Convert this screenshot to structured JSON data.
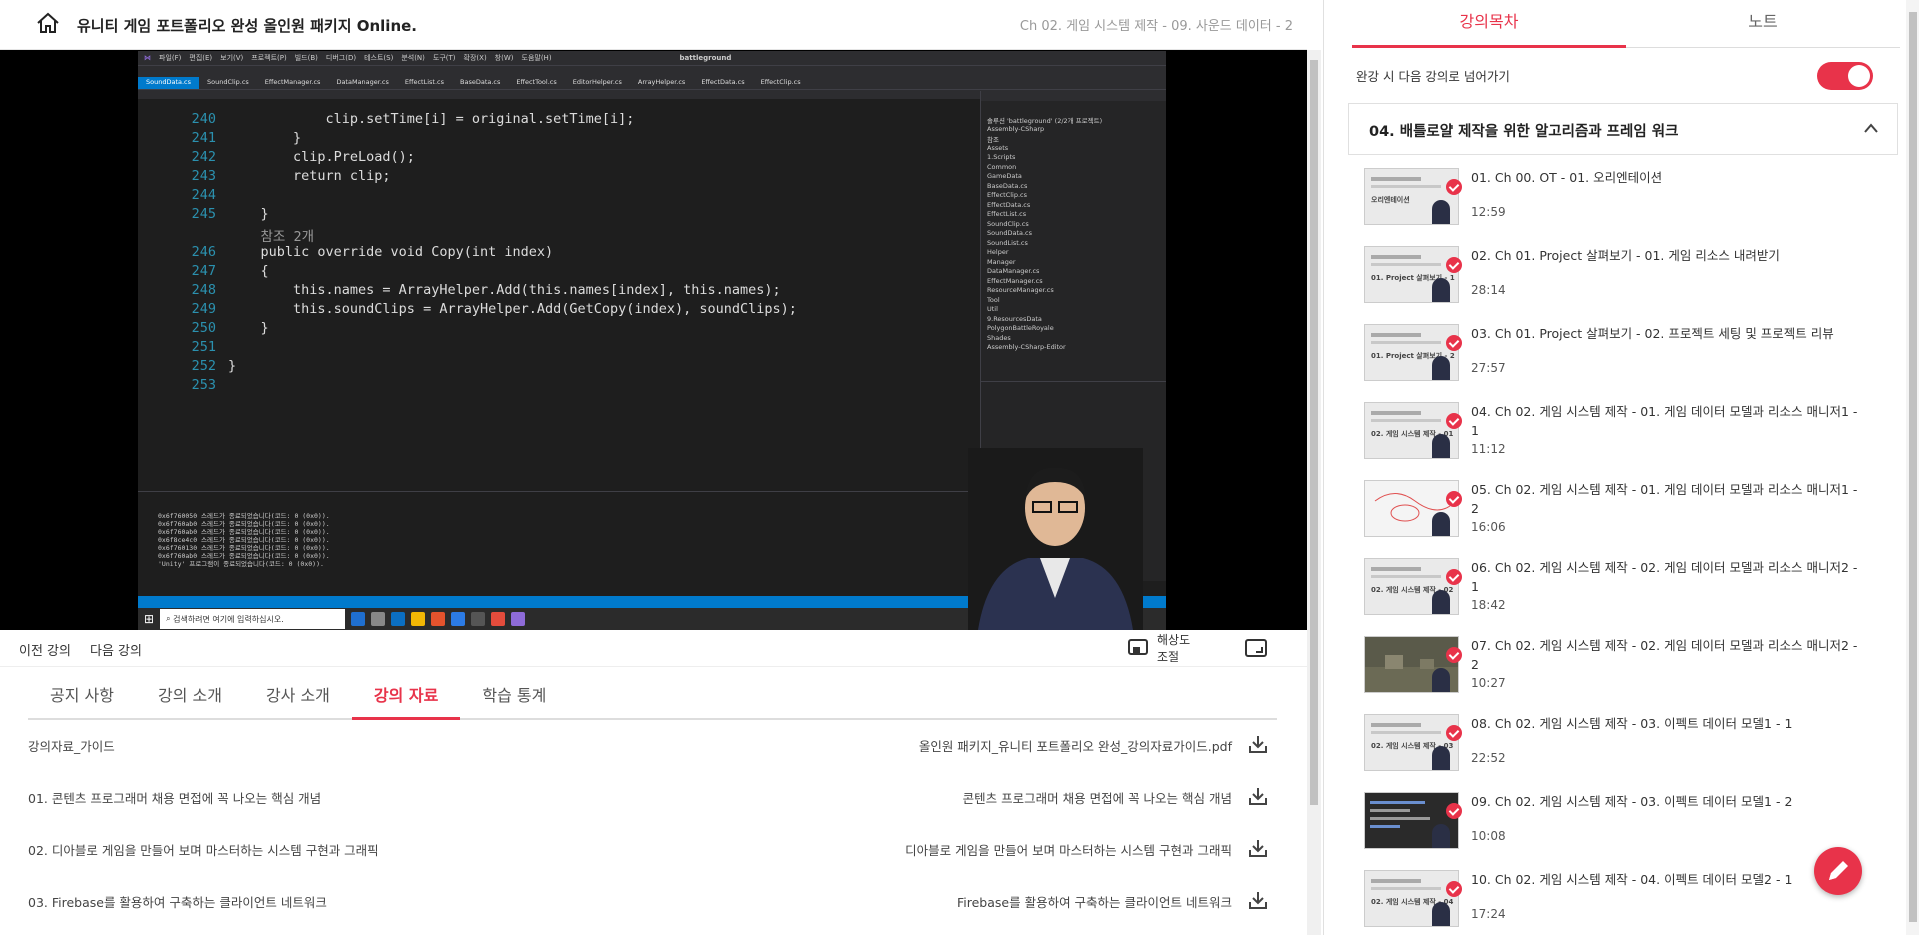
{
  "header": {
    "course_title": "유니티 게임 포트폴리오 완성 올인원 패키지 Online.",
    "chapter_label": "Ch 02. 게임 시스템 제작 - 09. 사운드 데이터 - 2"
  },
  "video": {
    "vs_menu": [
      "파일(F)",
      "편집(E)",
      "보기(V)",
      "프로젝트(P)",
      "빌드(B)",
      "디버그(D)",
      "테스트(S)",
      "분석(N)",
      "도구(T)",
      "확장(X)",
      "창(W)",
      "도움말(H)"
    ],
    "vs_project": "battleground",
    "vs_tabs": [
      "SoundData.cs",
      "SoundClip.cs",
      "EffectManager.cs",
      "DataManager.cs",
      "EffectList.cs",
      "BaseData.cs",
      "EffectTool.cs",
      "EditorHelper.cs",
      "ArrayHelper.cs",
      "EffectData.cs",
      "EffectClip.cs"
    ],
    "code_lines": [
      {
        "ln": "240",
        "text": "            clip.setTime[i] = original.setTime[i];"
      },
      {
        "ln": "241",
        "text": "        }"
      },
      {
        "ln": "242",
        "text": "        clip.PreLoad();"
      },
      {
        "ln": "243",
        "text": "        return clip;"
      },
      {
        "ln": "244",
        "text": ""
      },
      {
        "ln": "245",
        "text": "    }"
      },
      {
        "ln": "",
        "text": "    참조 2개"
      },
      {
        "ln": "246",
        "text": "    public override void Copy(int index)"
      },
      {
        "ln": "247",
        "text": "    {"
      },
      {
        "ln": "248",
        "text": "        this.names = ArrayHelper.Add(this.names[index], this.names);"
      },
      {
        "ln": "249",
        "text": "        this.soundClips = ArrayHelper.Add(GetCopy(index), soundClips);"
      },
      {
        "ln": "250",
        "text": "    }"
      },
      {
        "ln": "251",
        "text": ""
      },
      {
        "ln": "252",
        "text": "}"
      },
      {
        "ln": "253",
        "text": ""
      }
    ],
    "solution_tree": [
      "솔루션 'battleground' (2/2개 프로젝트)",
      "Assembly-CSharp",
      "참조",
      "Assets",
      "1.Scripts",
      "Common",
      "GameData",
      "BaseData.cs",
      "EffectClip.cs",
      "EffectData.cs",
      "EffectList.cs",
      "SoundClip.cs",
      "SoundData.cs",
      "SoundList.cs",
      "Helper",
      "Manager",
      "DataManager.cs",
      "EffectManager.cs",
      "ResourceManager.cs",
      "Tool",
      "Util",
      "9.ResourcesData",
      "PolygonBattleRoyale",
      "Shades",
      "Assembly-CSharp-Editor"
    ],
    "output_lines": [
      "0x6f760050 스레드가 종료되었습니다(코드: 0 (0x0)).",
      "0x6f760ab0 스레드가 종료되었습니다(코드: 0 (0x0)).",
      "0x6f760ab0 스레드가 종료되었습니다(코드: 0 (0x0)).",
      "0x6f8ce4c0 스레드가 종료되었습니다(코드: 0 (0x0)).",
      "0x6f760130 스레드가 종료되었습니다(코드: 0 (0x0)).",
      "0x6f760ab0 스레드가 종료되었습니다(코드: 0 (0x0)).",
      "'Unity' 프로그램이 종료되었습니다(코드: 0 (0x0))."
    ],
    "taskbar_search": "검색하려면 여기에 입력하십시오."
  },
  "controls": {
    "prev_label": "이전 강의",
    "next_label": "다음 강의",
    "resolution_line1": "해상도",
    "resolution_line2": "조절"
  },
  "tabs": [
    "공지 사항",
    "강의 소개",
    "강사 소개",
    "강의 자료",
    "학습 통계"
  ],
  "active_tab": "강의 자료",
  "resources": [
    {
      "left": "강의자료_가이드",
      "right": "올인원 패키지_유니티 포트폴리오 완성_강의자료가이드.pdf"
    },
    {
      "left": "01. 콘텐츠 프로그래머 채용 면접에 꼭 나오는 핵심 개념",
      "right": "콘텐츠 프로그래머 채용 면접에 꼭 나오는 핵심 개념"
    },
    {
      "left": "02. 디아블로 게임을 만들어 보며 마스터하는 시스템 구현과 그래픽",
      "right": "디아블로 게임을 만들어 보며 마스터하는 시스템 구현과 그래픽"
    },
    {
      "left": "03. Firebase를 활용하여 구축하는 클라이언트 네트워크",
      "right": "Firebase를 활용하여 구축하는 클라이언트 네트워크"
    }
  ],
  "sidebar": {
    "tab_toc": "강의목차",
    "tab_notes": "노트",
    "autoplay_label": "완강 시 다음 강의로 넘어가기",
    "autoplay_on": true,
    "section_title": "04. 배틀로얄 제작을 위한 알고리즘과 프레임 워크",
    "lectures": [
      {
        "title": "01. Ch 00. OT - 01. 오리엔테이션",
        "duration": "12:59",
        "thumb_text": "오리엔테이션"
      },
      {
        "title": "02. Ch 01. Project 살펴보기 - 01. 게임 리소스 내려받기",
        "duration": "28:14",
        "thumb_text": "01. Project 살펴보기 - 1"
      },
      {
        "title": "03. Ch 01. Project 살펴보기 - 02. 프로젝트 세팅 및 프로젝트 리뷰",
        "duration": "27:57",
        "thumb_text": "01. Project 살펴보기 - 2"
      },
      {
        "title": "04. Ch 02. 게임 시스템 제작 - 01. 게임 데이터 모델과 리소스 매니저1 - 1",
        "duration": "11:12",
        "thumb_text": "02. 게임 시스템 제작 - 01"
      },
      {
        "title": "05. Ch 02. 게임 시스템 제작 - 01. 게임 데이터 모델과 리소스 매니저1 - 2",
        "duration": "16:06",
        "thumb_text": ""
      },
      {
        "title": "06. Ch 02. 게임 시스템 제작 - 02. 게임 데이터 모델과 리소스 매니저2 - 1",
        "duration": "18:42",
        "thumb_text": "02. 게임 시스템 제작 - 02"
      },
      {
        "title": "07. Ch 02. 게임 시스템 제작 - 02. 게임 데이터 모델과 리소스 매니저2 - 2",
        "duration": "10:27",
        "thumb_text": ""
      },
      {
        "title": "08. Ch 02. 게임 시스템 제작 - 03. 이펙트 데이터 모델1 - 1",
        "duration": "22:52",
        "thumb_text": "02. 게임 시스템 제작 - 03"
      },
      {
        "title": "09. Ch 02. 게임 시스템 제작 - 03. 이펙트 데이터 모델1 - 2",
        "duration": "10:08",
        "thumb_text": ""
      },
      {
        "title": "10. Ch 02. 게임 시스템 제작 - 04. 이펙트 데이터 모델2 - 1",
        "duration": "17:24",
        "thumb_text": "02. 게임 시스템 제작 - 04"
      }
    ]
  },
  "colors": {
    "accent": "#e8334a",
    "vs_blue": "#007acc"
  }
}
